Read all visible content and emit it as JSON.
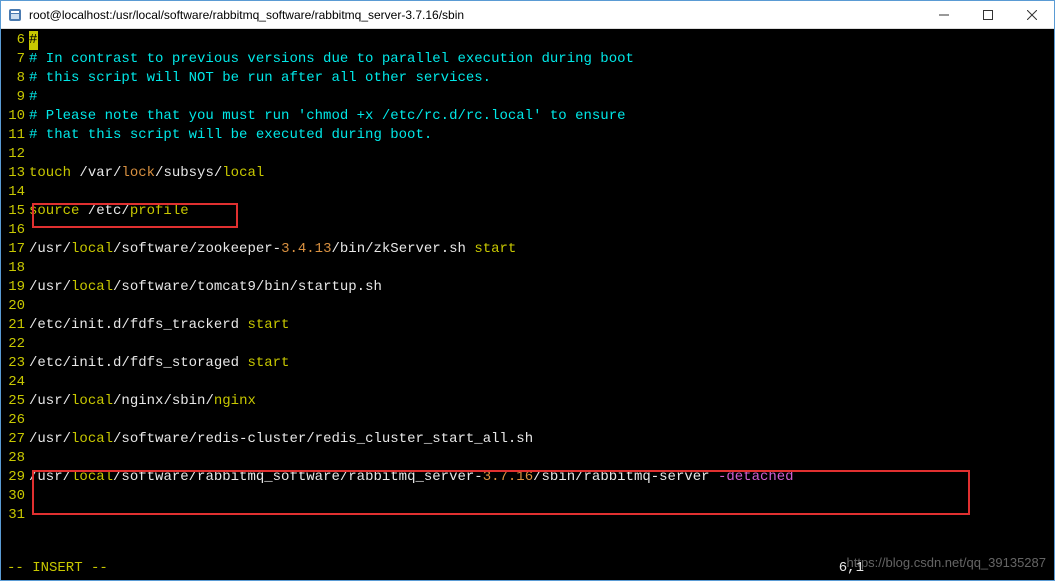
{
  "window": {
    "title": "root@localhost:/usr/local/software/rabbitmq_software/rabbitmq_server-3.7.16/sbin"
  },
  "lines": {
    "6": {
      "num": "6"
    },
    "7": {
      "num": "7",
      "comment": "# In contrast to previous versions due to parallel execution during boot"
    },
    "8": {
      "num": "8",
      "comment": "# this script will NOT be run after all other services."
    },
    "9": {
      "num": "9",
      "comment": "#"
    },
    "10": {
      "num": "10",
      "comment": "# Please note that you must run 'chmod +x /etc/rc.d/rc.local' to ensure"
    },
    "11": {
      "num": "11",
      "comment": "# that this script will be executed during boot."
    },
    "12": {
      "num": "12"
    },
    "13": {
      "num": "13",
      "kw": "touch ",
      "p1": "/var/",
      "p2": "lock",
      "p3": "/subsys/",
      "p4": "local"
    },
    "14": {
      "num": "14"
    },
    "15": {
      "num": "15",
      "kw": "source ",
      "p1": "/etc/",
      "p2": "profile"
    },
    "16": {
      "num": "16"
    },
    "17": {
      "num": "17",
      "p1": "/usr/",
      "p2": "local",
      "p3": "/software/zookeeper-",
      "p4": "3.4.13",
      "p5": "/bin/zkServer.sh ",
      "cmd": "start"
    },
    "18": {
      "num": "18"
    },
    "19": {
      "num": "19",
      "p1": "/usr/",
      "p2": "local",
      "p3": "/software/tomcat9/bin/startup.sh"
    },
    "20": {
      "num": "20"
    },
    "21": {
      "num": "21",
      "p1": "/etc/init.d/fdfs_trackerd ",
      "cmd": "start"
    },
    "22": {
      "num": "22"
    },
    "23": {
      "num": "23",
      "p1": "/etc/init.d/fdfs_storaged ",
      "cmd": "start"
    },
    "24": {
      "num": "24"
    },
    "25": {
      "num": "25",
      "p1": "/usr/",
      "p2": "local",
      "p3": "/nginx/sbin/",
      "p4": "nginx"
    },
    "26": {
      "num": "26"
    },
    "27": {
      "num": "27",
      "p1": "/usr/",
      "p2": "local",
      "p3": "/software/redis-cluster/redis_cluster_start_all.sh"
    },
    "28": {
      "num": "28"
    },
    "29": {
      "num": "29",
      "p1": "/usr/",
      "p2": "local",
      "p3": "/software/rabbitmq_software/rabbitmq_server-",
      "p4": "3.7.16",
      "p5": "/sbin/rabbitmq-server ",
      "flag": "-detached"
    },
    "30": {
      "num": "30"
    },
    "31": {
      "num": "31"
    }
  },
  "status": {
    "mode": "-- INSERT --",
    "cursor": "6,1"
  },
  "watermark": "https://blog.csdn.net/qq_39135287"
}
